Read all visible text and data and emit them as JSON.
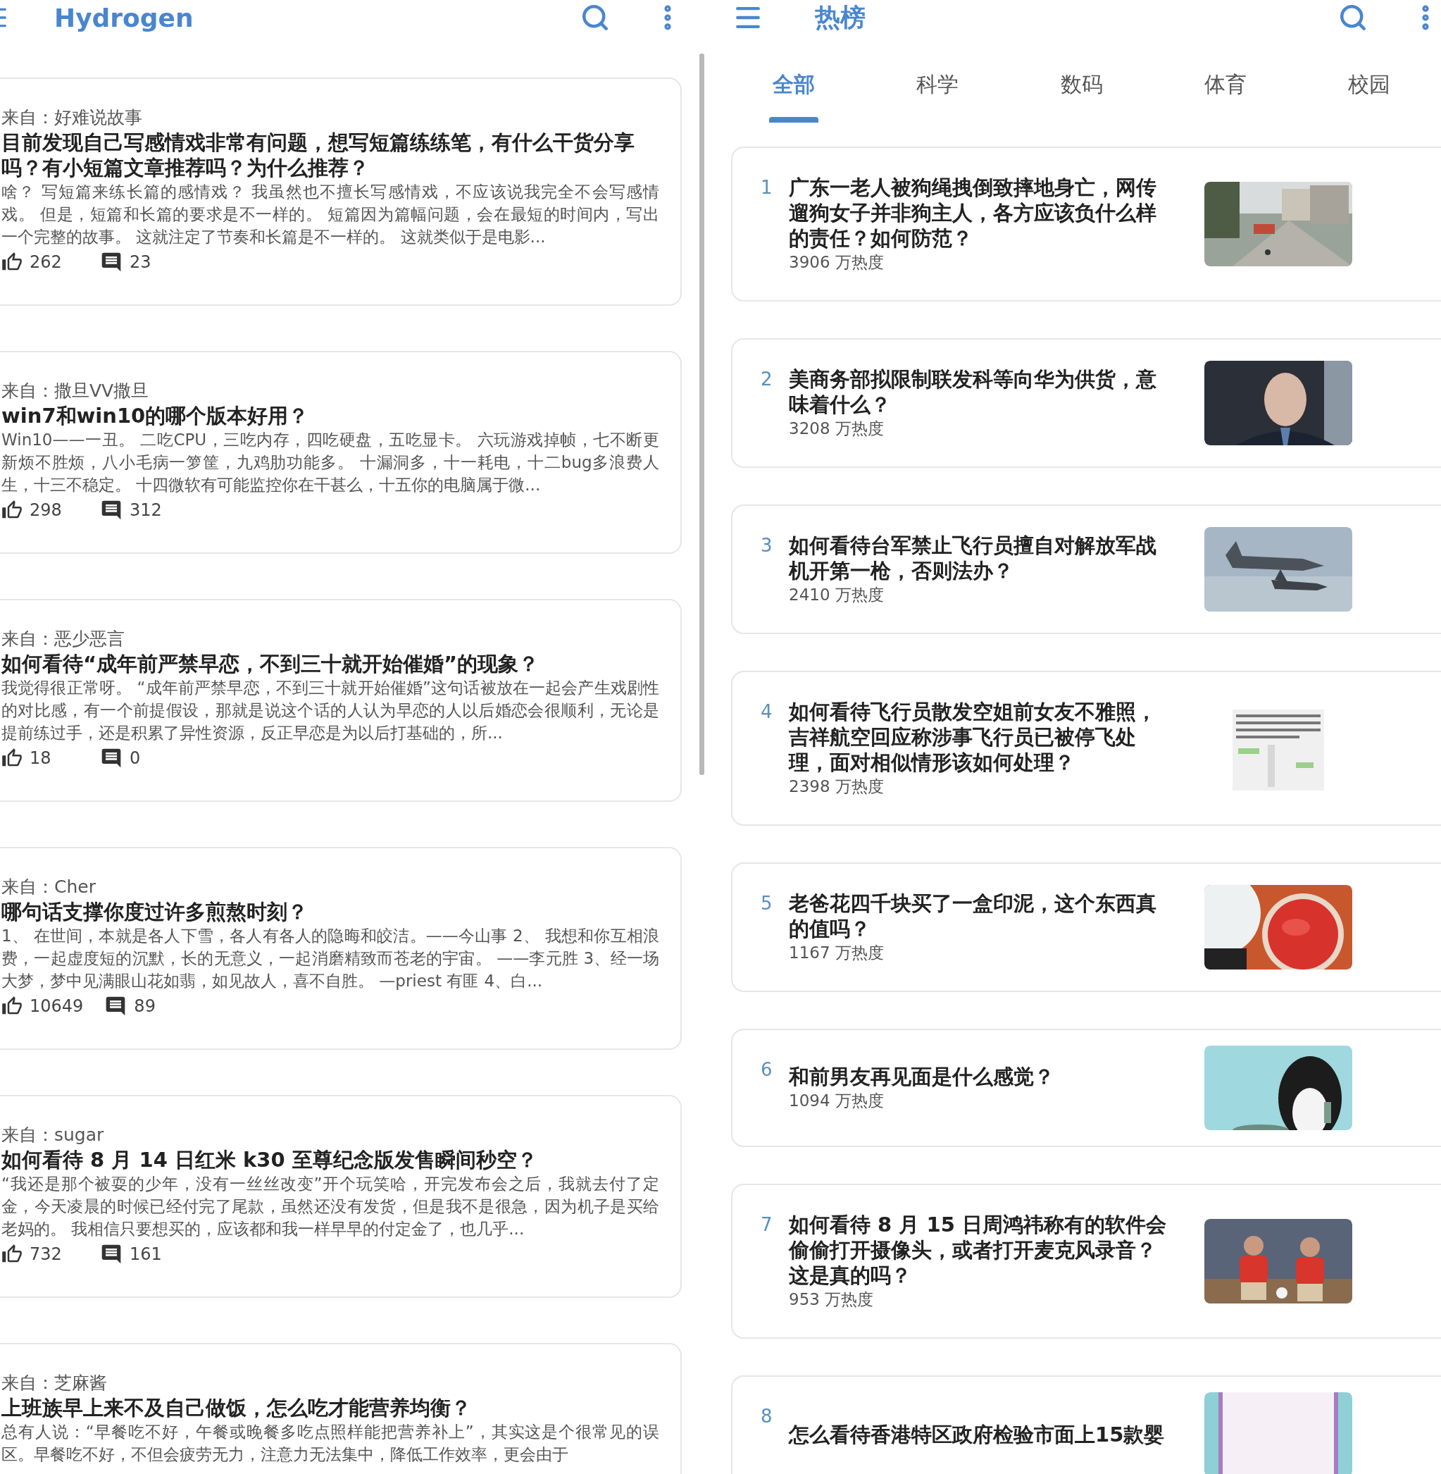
{
  "left_screen": {
    "app_bar": {
      "title": "Hydrogen"
    },
    "answers": [
      {
        "source": "来自：好难说故事",
        "title": "目前发现自己写感情戏非常有问题，想写短篇练练笔，有什么干货分享吗？有小短篇文章推荐吗？为什么推荐？",
        "excerpt": "啥？ 写短篇来练长篇的感情戏？ 我虽然也不擅长写感情戏，不应该说我完全不会写感情戏。 但是，短篇和长篇的要求是不一样的。 短篇因为篇幅问题，会在最短的时间内，写出一个完整的故事。 这就注定了节奏和长篇是不一样的。 这就类似于是电影...",
        "likes": "262",
        "comments": "23"
      },
      {
        "source": "来自：撒旦VV撒旦",
        "title": "win7和win10的哪个版本好用？",
        "excerpt": "Win10——一丑。 二吃CPU，三吃内存，四吃硬盘，五吃显卡。 六玩游戏掉帧，七不断更新烦不胜烦，八小毛病一箩筐，九鸡肋功能多。 十漏洞多，十一耗电，十二bug多浪费人生，十三不稳定。 十四微软有可能监控你在干甚么，十五你的电脑属于微...",
        "likes": "298",
        "comments": "312"
      },
      {
        "source": "来自：恶少恶言",
        "title": "如何看待“成年前严禁早恋，不到三十就开始催婚”的现象？",
        "excerpt": "我觉得很正常呀。 “成年前严禁早恋，不到三十就开始催婚”这句话被放在一起会产生戏剧性的对比感，有一个前提假设，那就是说这个话的人认为早恋的人以后婚恋会很顺利，无论是提前练过手，还是积累了异性资源，反正早恋是为以后打基础的，所...",
        "likes": "18",
        "comments": "0"
      },
      {
        "source": "来自：Cher",
        "title": "哪句话支撑你度过许多煎熬时刻？",
        "excerpt": "1、 在世间，本就是各人下雪，各人有各人的隐晦和皎洁。——今山事 2、 我想和你互相浪费，一起虚度短的沉默，长的无意义，一起消磨精致而苍老的宇宙。 ——李元胜 3、经一场大梦，梦中见满眼山花如翡，如见故人，喜不自胜。 —priest 有匪 4、白...",
        "likes": "10649",
        "comments": "89"
      },
      {
        "source": "来自：sugar",
        "title": "如何看待 8 月 14 日红米 k30 至尊纪念版发售瞬间秒空？",
        "excerpt": "“我还是那个被耍的少年，没有一丝丝改变”开个玩笑哈，开完发布会之后，我就去付了定金，今天凌晨的时候已经付完了尾款，虽然还没有发货，但是我不是很急，因为机子是买给老妈的。 我相信只要想买的，应该都和我一样早早的付定金了，也几乎...",
        "likes": "732",
        "comments": "161"
      },
      {
        "source": "来自：芝麻酱",
        "title": "上班族早上来不及自己做饭，怎么吃才能营养均衡？",
        "excerpt": "总有人说：“早餐吃不好，午餐或晚餐多吃点照样能把营养补上”，其实这是个很常见的误区。早餐吃不好，不但会疲劳无力，注意力无法集中，降低工作效率，更会由于"
      }
    ]
  },
  "right_screen": {
    "app_bar": {
      "title": "热榜"
    },
    "tabs": [
      {
        "label": "全部",
        "selected": true
      },
      {
        "label": "科学",
        "selected": false
      },
      {
        "label": "数码",
        "selected": false
      },
      {
        "label": "体育",
        "selected": false
      },
      {
        "label": "校园",
        "selected": false
      }
    ],
    "hot_list": [
      {
        "rank": "1",
        "title": "广东一老人被狗绳拽倒致摔地身亡，网传遛狗女子并非狗主人，各方应该负什么样的责任？如何防范？",
        "heat": "3906 万热度"
      },
      {
        "rank": "2",
        "title": "美商务部拟限制联发科等向华为供货，意味着什么？",
        "heat": "3208 万热度"
      },
      {
        "rank": "3",
        "title": "如何看待台军禁止飞行员擅自对解放军战机开第一枪，否则法办？",
        "heat": "2410 万热度"
      },
      {
        "rank": "4",
        "title": "如何看待飞行员散发空姐前女友不雅照，吉祥航空回应称涉事飞行员已被停飞处理，面对相似情形该如何处理？",
        "heat": "2398 万热度"
      },
      {
        "rank": "5",
        "title": "老爸花四千块买了一盒印泥，这个东西真的值吗？",
        "heat": "1167 万热度"
      },
      {
        "rank": "6",
        "title": "和前男友再见面是什么感觉？",
        "heat": "1094 万热度"
      },
      {
        "rank": "7",
        "title": "如何看待 8 月 15 日周鸿祎称有的软件会偷偷打开摄像头，或者打开麦克风录音？这是真的吗？",
        "heat": "953 万热度"
      },
      {
        "rank": "8",
        "title": "怎么看待香港特区政府检验市面上15款婴"
      }
    ]
  }
}
